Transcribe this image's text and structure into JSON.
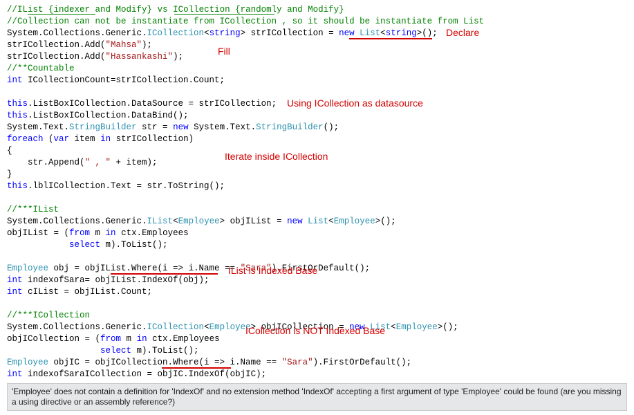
{
  "code": {
    "l01a": "//",
    "l01b": "IList {indexer",
    "l01c": " and Modify} vs ",
    "l01d": "ICollection {randomly",
    "l01e": " and Modify}",
    "l02": "//Collection can not be instantiate from ICollection , so it should be instantiate from List",
    "l03a": "System.Collections.Generic.",
    "l03b": "ICollection",
    "l03c": "<",
    "l03d": "string",
    "l03e": "> strICollection = ",
    "l03f": "new",
    "l03g": " ",
    "l03h": "List",
    "l03i": "<",
    "l03j": "string",
    "l03k": ">();",
    "l04a": "strICollection.Add(",
    "l04b": "\"Mahsa\"",
    "l04c": ");",
    "l05a": "strICollection.Add(",
    "l05b": "\"Hassankashi\"",
    "l05c": ");",
    "l06": "//**Countable",
    "l07a": "int",
    "l07b": " ICollectionCount=strICollection.Count;",
    "l08a": "this",
    "l08b": ".ListBoxICollection.DataSource = strICollection;",
    "l09a": "this",
    "l09b": ".ListBoxICollection.DataBind();",
    "l10a": "System.Text.",
    "l10b": "StringBuilder",
    "l10c": " str = ",
    "l10d": "new",
    "l10e": " System.Text.",
    "l10f": "StringBuilder",
    "l10g": "();",
    "l11a": "foreach",
    "l11b": " (",
    "l11c": "var",
    "l11d": " item ",
    "l11e": "in",
    "l11f": " strICollection)",
    "l12": "{",
    "l13a": "    str.Append(",
    "l13b": "\" , \"",
    "l13c": " + item);",
    "l14": "}",
    "l15a": "this",
    "l15b": ".lblICollection.Text = str.ToString();",
    "l16": "//***IList",
    "l17a": "System.Collections.Generic.",
    "l17b": "IList",
    "l17c": "<",
    "l17d": "Employee",
    "l17e": "> objIList = ",
    "l17f": "new",
    "l17g": " ",
    "l17h": "List",
    "l17i": "<",
    "l17j": "Employee",
    "l17k": ">();",
    "l18a": "objIList = (",
    "l18b": "from",
    "l18c": " m ",
    "l18d": "in",
    "l18e": " ctx.Employees",
    "l19a": "            ",
    "l19b": "select",
    "l19c": " m).ToList();",
    "l20a": "Employee",
    "l20b": " obj = objIList.Where(i => i.Name == ",
    "l20c": "\"Sara\"",
    "l20d": ").FirstOrDefault();",
    "l21a": "int",
    "l21b": " indexofSara= objIList.IndexOf(obj);",
    "l22a": "int",
    "l22b": " cIList = objIList.Count;",
    "l23": "//***ICollection",
    "l24a": "System.Collections.Generic.",
    "l24b": "ICollection",
    "l24c": "<",
    "l24d": "Employee",
    "l24e": "> objICollection = ",
    "l24f": "new",
    "l24g": " ",
    "l24h": "List",
    "l24i": "<",
    "l24j": "Employee",
    "l24k": ">();",
    "l25a": "objICollection = (",
    "l25b": "from",
    "l25c": " m ",
    "l25d": "in",
    "l25e": " ctx.Employees",
    "l26a": "                  ",
    "l26b": "select",
    "l26c": " m).ToList();",
    "l27a": "Employee",
    "l27b": " objIC = objICollection.Where(i => i.Name == ",
    "l27c": "\"Sara\"",
    "l27d": ").FirstOrDefault();",
    "l28a": "int",
    "l28b": " indexofSaraICollection = objIC.IndexOf(objIC);"
  },
  "annotations": {
    "declare": "Declare",
    "fill": "Fill",
    "using_ds": "Using ICollection as datasource",
    "iterate": "Iterate inside ICollection",
    "ilist_idx": "IList is Indexed Base",
    "icoll_idx": "ICollection is NOT Indexed Base"
  },
  "tooltip": "'Employee' does not contain a definition for 'IndexOf' and no extension method 'IndexOf' accepting a first argument of type 'Employee' could be found (are you missing a using directive or an assembly reference?)"
}
